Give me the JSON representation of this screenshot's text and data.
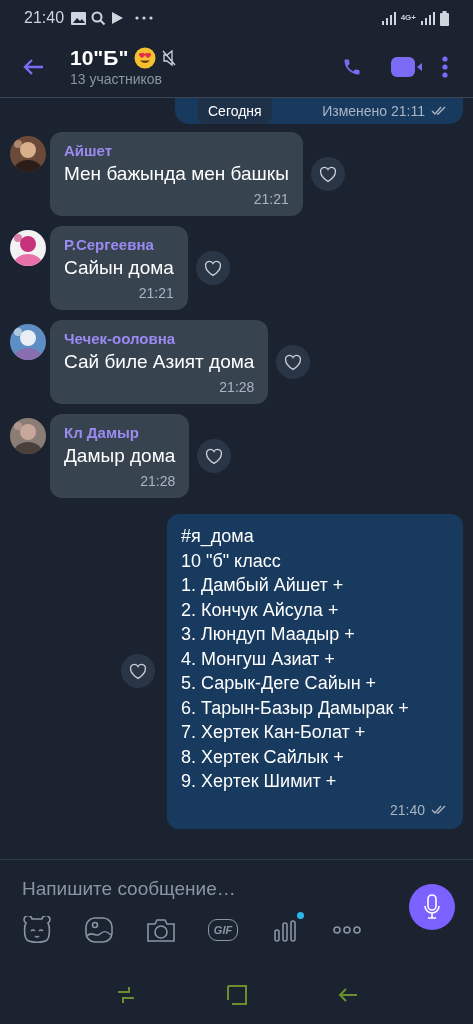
{
  "status_bar": {
    "time": "21:40",
    "network": "4G+"
  },
  "header": {
    "title": "10\"Б\"",
    "muted": true,
    "subtitle": "13 участников"
  },
  "previous_message": {
    "edited": "Изменено 21:11",
    "read": true
  },
  "date_divider": "Сегодня",
  "messages": [
    {
      "kind": "incoming",
      "sender": "Айшет",
      "text": "Мен бажында мен башкы",
      "time": "21:21",
      "liked": false
    },
    {
      "kind": "incoming",
      "sender": "Р.Сергеевна",
      "text": "Сайын дома",
      "time": "21:21",
      "liked": false
    },
    {
      "kind": "incoming",
      "sender": "Чечек-ооловна",
      "text": "Сай биле Азият дома",
      "time": "21:28",
      "liked": false
    },
    {
      "kind": "incoming",
      "sender": "Кл Дамыр",
      "text": "Дамыр дома",
      "time": "21:28",
      "liked": false
    },
    {
      "kind": "outgoing",
      "text": "#я_дома\n10 \"б\" класс\n1. Дамбый Айшет +\n2. Кончук Айсула +\n3. Люндуп Маадыр +\n4. Монгуш Азиат +\n5. Сарык-Деге Сайын +\n6. Тарын-Базыр Дамырак +\n7. Хертек Кан-Болат +\n8. Хертек Сайлык +\n9. Хертек Шимит +",
      "time": "21:40",
      "read": true,
      "liked": false
    }
  ],
  "composer": {
    "placeholder": "Напишите сообщение…"
  },
  "tools": [
    {
      "kind": "sticker",
      "notification": false
    },
    {
      "kind": "gallery",
      "notification": false
    },
    {
      "kind": "camera",
      "notification": false
    },
    {
      "kind": "gif",
      "label": "GIF",
      "notification": false
    },
    {
      "kind": "chart",
      "notification": true
    },
    {
      "kind": "more",
      "notification": false
    }
  ]
}
